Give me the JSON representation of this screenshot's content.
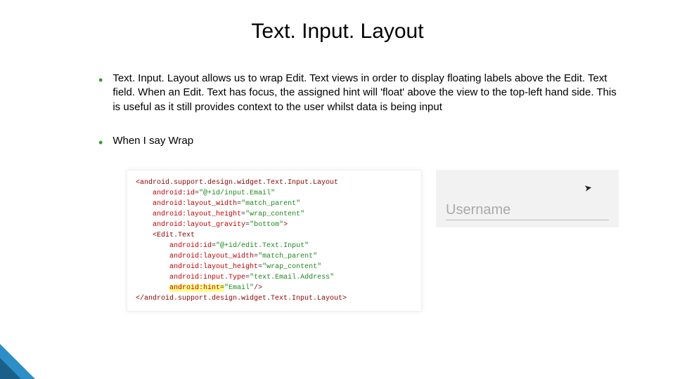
{
  "title": "Text. Input. Layout",
  "bullets": [
    "Text. Input. Layout allows us to wrap Edit. Text views in order to display floating labels above the Edit. Text field. When an Edit. Text has focus, the assigned hint will 'float' above the view to the top-left hand side. This is useful as it still provides context to the user whilst data is being input",
    "When I say Wrap"
  ],
  "code": {
    "open_tag": "<android.support.design.widget.Text.Input.Layout",
    "attrs_outer": [
      {
        "name": "android:id",
        "value": "\"@+id/input.Email\""
      },
      {
        "name": "android:layout_width",
        "value": "\"match_parent\""
      },
      {
        "name": "android:layout_height",
        "value": "\"wrap_content\""
      },
      {
        "name": "android:layout_gravity",
        "value": "\"bottom\"",
        "close": ">"
      }
    ],
    "inner_open": "<Edit.Text",
    "attrs_inner": [
      {
        "name": "android:id",
        "value": "\"@+id/edit.Text.Input\""
      },
      {
        "name": "android:layout_width",
        "value": "\"match_parent\""
      },
      {
        "name": "android:layout_height",
        "value": "\"wrap_content\""
      },
      {
        "name": "android:input.Type",
        "value": "\"text.Email.Address\""
      },
      {
        "name": "android:hint",
        "value": "\"Email\"",
        "close": "/>",
        "hl": true
      }
    ],
    "close_tag": "</android.support.design.widget.Text.Input.Layout>"
  },
  "preview": {
    "label": "Username"
  }
}
